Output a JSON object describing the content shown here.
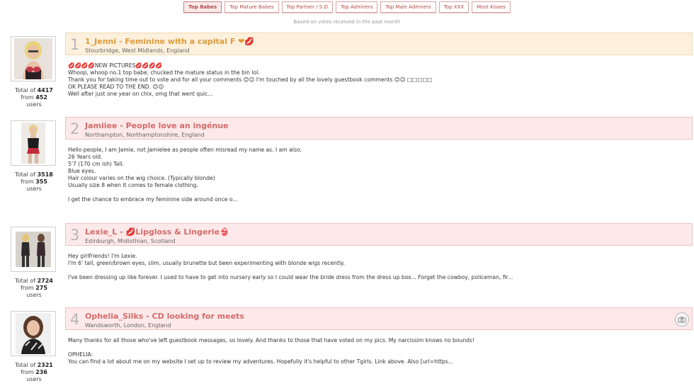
{
  "tabs": [
    {
      "label": "Top Babes",
      "active": true
    },
    {
      "label": "Top Mature Babes",
      "active": false
    },
    {
      "label": "Top Partner / S.O",
      "active": false
    },
    {
      "label": "Top Admirers",
      "active": false
    },
    {
      "label": "Top Male Admirers",
      "active": false
    },
    {
      "label": "Top XXX",
      "active": false
    },
    {
      "label": "Most Kisses",
      "active": false
    }
  ],
  "subtitle": "Based on votes received in the past month",
  "entries": [
    {
      "rank": "1",
      "headline": "1_Jenni - Feminine with a capital F ❤💋",
      "location": "Stourbridge, West Midlands, England",
      "total_label": "Total of",
      "total": "4417",
      "from_label": "from",
      "users": "452",
      "users_label": "users",
      "body": "💋💋💋💋NEW PICTURES💋💋💋💋\nWhoop, whoop no.1 top babe, chucked the mature status in the bin lol.\nThank you for taking time out to vote and for all your comments 😊😉 I'm touched by all the lovely guestbook comments 😊😉 □□□□□\nOK PLEASE READ TO THE END. 😊😉\nWell after just one year on chix, omg that went quic..."
    },
    {
      "rank": "2",
      "headline": "Jamiiee - People love an ingénue",
      "location": "Northampton, Northamptonshire, England",
      "total_label": "Total of",
      "total": "3518",
      "from_label": "from",
      "users": "355",
      "users_label": "users",
      "body": "Hello people, I am Jamie, not Jamielee as people often misread my name as. I am also;\n26 Years old.\n5'7 (170 cm ish) Tall.\nBlue eyes.\nHair colour varies on the wig choice. (Typically blonde)\nUsually size 8 when it comes to female clothing.\n\nI get the chance to embrace my feminine side around once o..."
    },
    {
      "rank": "3",
      "headline": "Lexie_L - 💋Lipgloss & Lingerie👙",
      "location": "Edinburgh, Midlothian, Scotland",
      "total_label": "Total of",
      "total": "2724",
      "from_label": "from",
      "users": "275",
      "users_label": "users",
      "body": "Hey girlfriends! I'm Lexie.\nI'm 6' tall, green/brown eyes, slim, usually brunette but been experimenting with blonde wigs recently.\n\nI've been dressing up like forever. I used to have to get into nursery early so I could wear the bride dress from the dress up box... Forget the cowboy, policeman, fir..."
    },
    {
      "rank": "4",
      "headline": "Ophelia_Silks - CD looking for meets",
      "location": "Wandsworth, London, England",
      "total_label": "Total of",
      "total": "2321",
      "from_label": "from",
      "users": "236",
      "users_label": "users",
      "body": "Many thanks for all those who've left guestbook messages, so lovely. And thanks to those that have voted on my pics. My narcissim knows no bounds!\n\nOPHELIA:\nYou can find a lot about me on my website I set up to review my adventures. Hopefully it's helpful to other Tgirls. Link above. Also [url=https..."
    }
  ]
}
